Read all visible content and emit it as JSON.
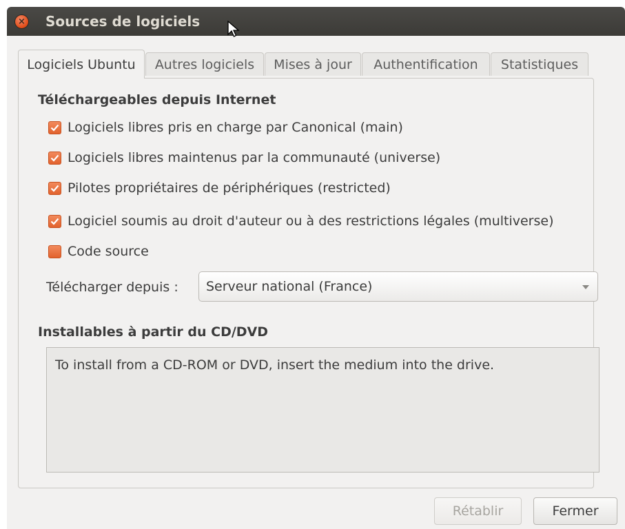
{
  "window": {
    "title": "Sources de logiciels"
  },
  "tabs": [
    {
      "label": "Logiciels Ubuntu",
      "active": true
    },
    {
      "label": "Autres logiciels",
      "active": false
    },
    {
      "label": "Mises à jour",
      "active": false
    },
    {
      "label": "Authentification",
      "active": false
    },
    {
      "label": "Statistiques",
      "active": false
    }
  ],
  "internet": {
    "heading": "Téléchargeables depuis Internet",
    "options": [
      {
        "label": "Logiciels libres pris en charge par Canonical (main)",
        "checked": true
      },
      {
        "label": "Logiciels libres maintenus par la communauté (universe)",
        "checked": true
      },
      {
        "label": "Pilotes propriétaires de périphériques (restricted)",
        "checked": true
      },
      {
        "label": "Logiciel soumis au droit d'auteur ou à des restrictions légales (multiverse)",
        "checked": true
      },
      {
        "label": "Code source",
        "checked": false
      }
    ],
    "download_from_label": "Télécharger depuis :",
    "download_from_value": "Serveur national (France)"
  },
  "cdrom": {
    "heading": "Installables à partir du CD/DVD",
    "message": "To install from a CD-ROM or DVD, insert the medium into the drive."
  },
  "buttons": {
    "revert": "Rétablir",
    "close": "Fermer"
  },
  "colors": {
    "accent": "#e2622d",
    "titlebar": "#3c3b37",
    "background": "#f2f1f0"
  }
}
